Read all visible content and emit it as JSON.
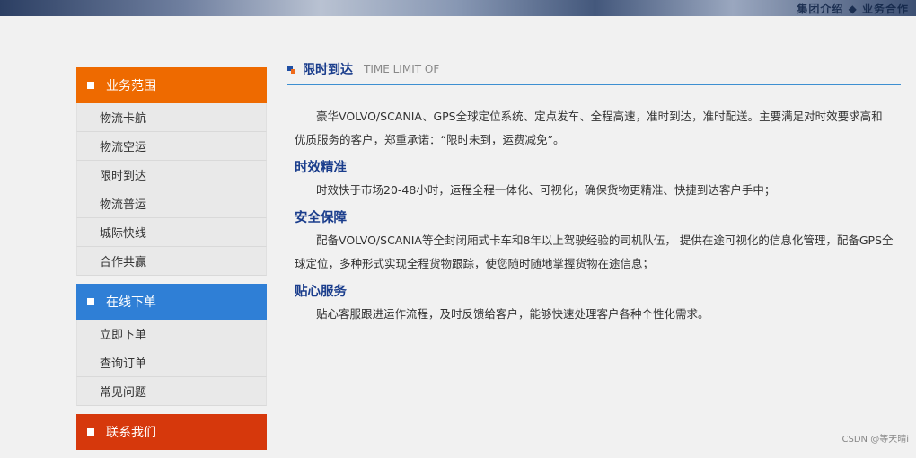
{
  "banner": {
    "text": "集团介绍 ◆ 业务合作"
  },
  "sidebar": {
    "groups": [
      {
        "title": "业务范围",
        "color": "#ee6a00",
        "items": [
          "物流卡航",
          "物流空运",
          "限时到达",
          "物流普运",
          "城际快线",
          "合作共赢"
        ]
      },
      {
        "title": "在线下单",
        "color": "#2f7fd6",
        "items": [
          "立即下单",
          "查询订单",
          "常见问题"
        ]
      },
      {
        "title": "联系我们",
        "color": "#d6380c",
        "items": []
      }
    ]
  },
  "main": {
    "title": "限时到达",
    "subtitle": "TIME LIMIT OF",
    "intro": "豪华VOLVO/SCANIA、GPS全球定位系统、定点发车、全程高速，准时到达，准时配送。主要满足对时效要求高和优质服务的客户，郑重承诺：“限时未到，运费减免”。",
    "sections": [
      {
        "title": "时效精准",
        "text": "时效快于市场20-48小时，运程全程一体化、可视化，确保货物更精准、快捷到达客户手中；"
      },
      {
        "title": "安全保障",
        "text": "配备VOLVO/SCANIA等全封闭厢式卡车和8年以上驾驶经验的司机队伍， 提供在途可视化的信息化管理，配备GPS全球定位，多种形式实现全程货物跟踪，使您随时随地掌握货物在途信息；"
      },
      {
        "title": "贴心服务",
        "text": "贴心客服跟进运作流程，及时反馈给客户，能够快速处理客户各种个性化需求。"
      }
    ]
  },
  "footer": {
    "watermark": "CSDN @等天晴i"
  }
}
